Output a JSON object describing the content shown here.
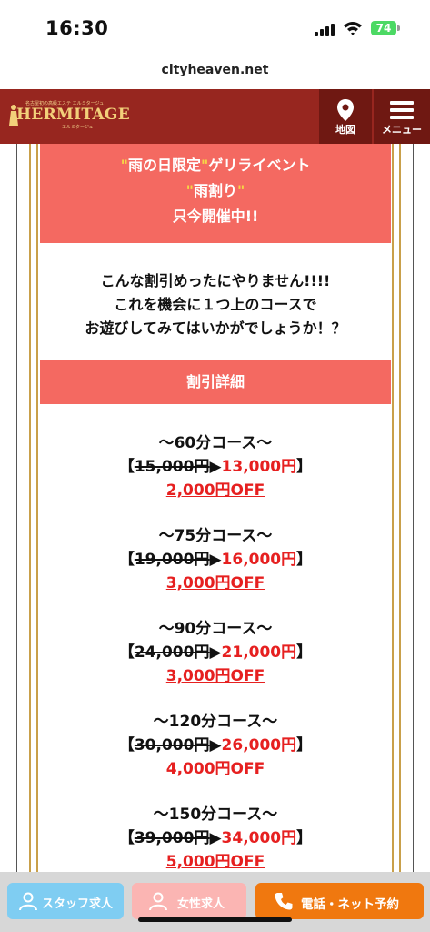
{
  "status_bar": {
    "time": "16:30",
    "battery": "74"
  },
  "browser": {
    "url": "cityheaven.net"
  },
  "header": {
    "logo": {
      "name": "HERMITAGE",
      "tagline": "名古屋初の高級エステ エルミタージュ",
      "subline": "エルミタージュ"
    },
    "map_label": "地図",
    "menu_label": "メニュー"
  },
  "event": {
    "line1_open": "\"",
    "line1_em": "雨の日限定",
    "line1_close": "\"",
    "line1_rest": "ゲリライベント",
    "line2_open": "\"",
    "line2_em": "雨割り",
    "line2_close": "\"",
    "line3": "只今開催中!!"
  },
  "message": {
    "line1": "こんな割引めったにやりません!!!!",
    "line2": "これを機会に１つ上のコースで",
    "line3": "お遊びしてみてはいかがでしょうか！？"
  },
  "details_heading": "割引詳細",
  "courses": [
    {
      "title": "〜60分コース〜",
      "old": "15,000円",
      "new": "13,000円",
      "off": "2,000円OFF"
    },
    {
      "title": "〜75分コース〜",
      "old": "19,000円",
      "new": "16,000円",
      "off": "3,000円OFF"
    },
    {
      "title": "〜90分コース〜",
      "old": "24,000円",
      "new": "21,000円",
      "off": "3,000円OFF"
    },
    {
      "title": "〜120分コース〜",
      "old": "30,000円",
      "new": "26,000円",
      "off": "4,000円OFF"
    },
    {
      "title": "〜150分コース〜",
      "old": "39,000円",
      "new": "34,000円",
      "off": "5,000円OFF"
    }
  ],
  "bottom_bar": {
    "staff": "スタッフ求人",
    "female": "女性求人",
    "reserve": "電話・ネット予約"
  },
  "colors": {
    "header": "#97261f",
    "event_red": "#f46961",
    "price_red": "#e62020",
    "gold": "#c9a04a",
    "staff_btn": "#7fcdf2",
    "female_btn": "#fbb5b3",
    "reserve_btn": "#f0780f"
  }
}
